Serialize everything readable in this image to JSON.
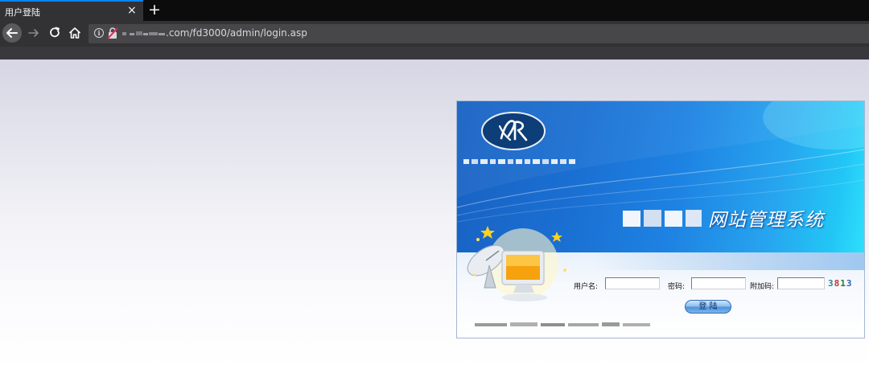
{
  "browser": {
    "tab_title": "用户登陆",
    "tab_close": "×",
    "new_tab": "+",
    "url_suffix": ".com/fd3000/admin/login.asp",
    "info_glyph": "i"
  },
  "login": {
    "system_title": "网站管理系统",
    "username_label": "用户名:",
    "username_value": "",
    "password_label": "密码:",
    "password_value": "",
    "captcha_label": "附加码:",
    "captcha_value": "",
    "captcha_code": [
      "3",
      "8",
      "1",
      "3"
    ],
    "captcha_colors": [
      "#2f7f9a",
      "#c0392b",
      "#2a7a2a",
      "#2f5fb0"
    ],
    "submit_label": "登 陆"
  },
  "colors": {
    "tab_accent": "#0a84ff",
    "banner_dark": "#1862c3",
    "banner_light": "#2ee0fb"
  },
  "icons": [
    "back-arrow-icon",
    "forward-arrow-icon",
    "reload-icon",
    "home-icon",
    "info-icon",
    "insecure-lock-icon",
    "close-icon",
    "plus-icon"
  ]
}
